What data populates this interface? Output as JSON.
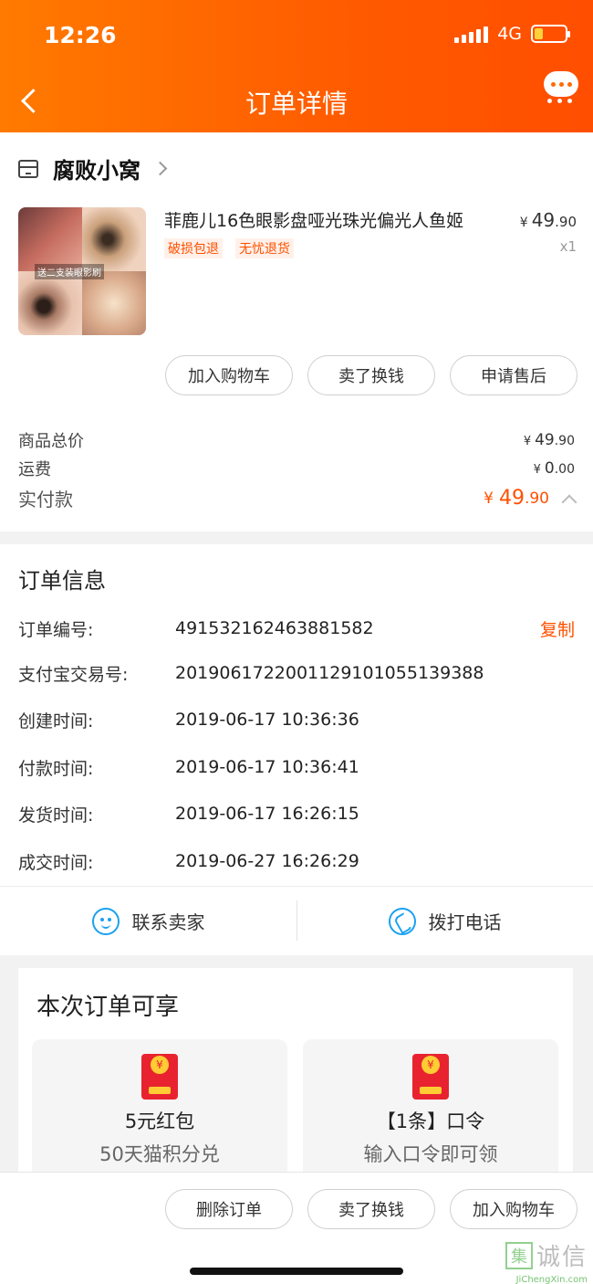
{
  "status_bar": {
    "time": "12:26",
    "network": "4G"
  },
  "nav": {
    "title": "订单详情"
  },
  "shop": {
    "name": "腐败小窝"
  },
  "product": {
    "title": "菲鹿儿16色眼影盘哑光珠光偏光人鱼姬",
    "image_caption": "送二支装眼影刷",
    "tags": [
      "破损包退",
      "无忧退货"
    ],
    "price_yen": "¥",
    "price_int": "49",
    "price_dec": ".90",
    "quantity": "x1"
  },
  "item_actions": [
    "加入购物车",
    "卖了换钱",
    "申请售后"
  ],
  "summary": {
    "goods_total_label": "商品总价",
    "goods_total_int": "49",
    "goods_total_dec": ".90",
    "shipping_label": "运费",
    "shipping_int": "0",
    "shipping_dec": ".00",
    "paid_label": "实付款",
    "paid_int": "49",
    "paid_dec": ".90",
    "currency": "¥"
  },
  "order_info": {
    "title": "订单信息",
    "copy_label": "复制",
    "rows": [
      {
        "label": "订单编号:",
        "value": "491532162463881582"
      },
      {
        "label": "支付宝交易号:",
        "value": "2019061722001129101055139388"
      },
      {
        "label": "创建时间:",
        "value": "2019-06-17 10:36:36"
      },
      {
        "label": "付款时间:",
        "value": "2019-06-17 10:36:41"
      },
      {
        "label": "发货时间:",
        "value": "2019-06-17 16:26:15"
      },
      {
        "label": "成交时间:",
        "value": "2019-06-27 16:26:29"
      }
    ]
  },
  "contact": {
    "seller_label": "联系卖家",
    "phone_label": "拨打电话"
  },
  "benefits": {
    "title": "本次订单可享",
    "items": [
      {
        "title": "5元红包",
        "subtitle": "50天猫积分兑"
      },
      {
        "title": "【1条】口令",
        "subtitle": "输入口令即可领"
      }
    ]
  },
  "bottom_actions": [
    "删除订单",
    "卖了换钱",
    "加入购物车"
  ],
  "watermark": {
    "text": "诚信",
    "mark": "集",
    "sub": "JiChengXin.com"
  },
  "colors": {
    "accent": "#ff5000",
    "header_start": "#ff7a00",
    "header_end": "#ff4e00",
    "icon_blue": "#1aa1f0"
  }
}
